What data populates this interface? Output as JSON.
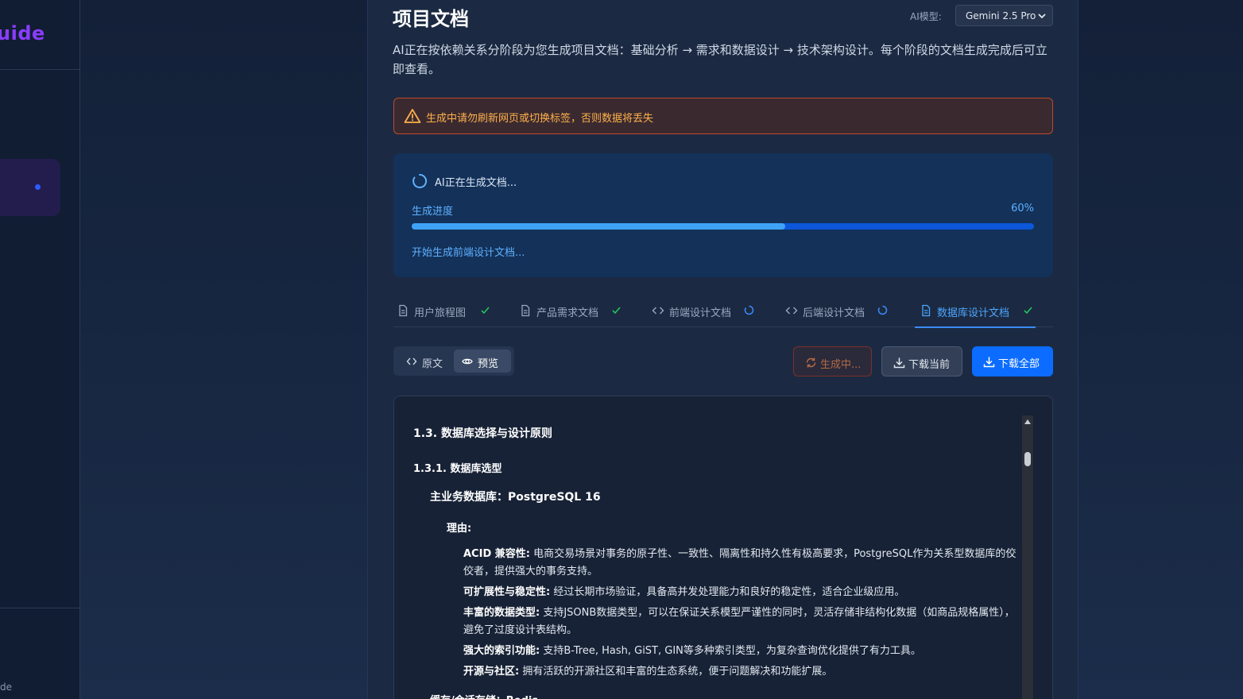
{
  "sidebar": {
    "brand": "uide",
    "footer": "de"
  },
  "header": {
    "title": "项目文档",
    "model_label": "AI模型:",
    "model_value": "Gemini 2.5 Pro",
    "description": "AI正在按依赖关系分阶段为您生成项目文档：基础分析 → 需求和数据设计 → 技术架构设计。每个阶段的文档生成完成后可立即查看。"
  },
  "warning": {
    "text": "生成中请勿刷新网页或切换标签，否则数据将丢失",
    "color": "#ffb04a"
  },
  "progress": {
    "title": "AI正在生成文档...",
    "label": "生成进度",
    "percent_text": "60%",
    "value": 0.6,
    "step": "开始生成前端设计文档..."
  },
  "tabs": [
    {
      "label": "用户旅程图",
      "icon": "file-icon",
      "status": "done"
    },
    {
      "label": "产品需求文档",
      "icon": "file-icon",
      "status": "done"
    },
    {
      "label": "前端设计文档",
      "icon": "code-icon",
      "status": "loading"
    },
    {
      "label": "后端设计文档",
      "icon": "code-icon",
      "status": "loading"
    },
    {
      "label": "数据库设计文档",
      "icon": "file-icon",
      "status": "done"
    }
  ],
  "view_toggle": {
    "raw": "原文",
    "preview": "预览"
  },
  "actions": {
    "generating": "生成中...",
    "download_current": "下载当前",
    "download_all": "下载全部"
  },
  "document": {
    "h3": "1.3. 数据库选择与设计原则",
    "h4": "1.3.1. 数据库选型",
    "main_db": "主业务数据库：PostgreSQL 16",
    "reason_label": "理由:",
    "reasons": [
      {
        "key": "ACID 兼容性:",
        "text": " 电商交易场景对事务的原子性、一致性、隔离性和持久性有极高要求，PostgreSQL作为关系型数据库的佼佼者，提供强大的事务支持。"
      },
      {
        "key": "可扩展性与稳定性:",
        "text": " 经过长期市场验证，具备高并发处理能力和良好的稳定性，适合企业级应用。"
      },
      {
        "key": "丰富的数据类型:",
        "text": " 支持JSONB数据类型，可以在保证关系模型严谨性的同时，灵活存储非结构化数据（如商品规格属性），避免了过度设计表结构。"
      },
      {
        "key": "强大的索引功能:",
        "text": " 支持B-Tree, Hash, GiST, GIN等多种索引类型，为复杂查询优化提供了有力工具。"
      },
      {
        "key": "开源与社区:",
        "text": " 拥有活跃的开源社区和丰富的生态系统，便于问题解决和功能扩展。"
      }
    ],
    "cut_line": "缓存/会话存储：Redis"
  }
}
